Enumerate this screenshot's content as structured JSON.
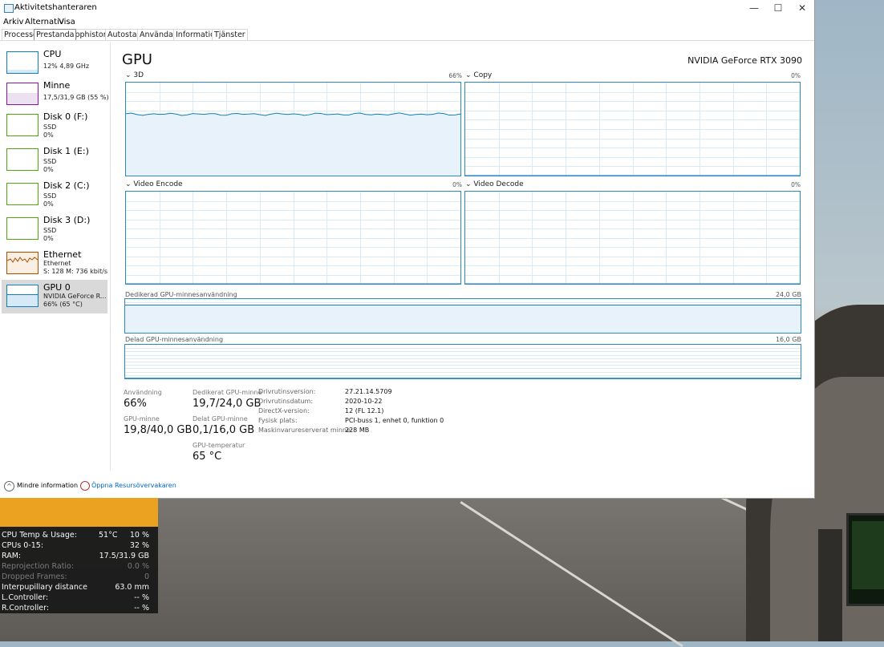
{
  "window": {
    "title": "Aktivitetshanteraren",
    "controls": {
      "minimize": "—",
      "maximize": "☐",
      "close": "✕"
    }
  },
  "menu": [
    "Arkiv",
    "Alternativ",
    "Visa"
  ],
  "tabs": [
    {
      "label": "Processer"
    },
    {
      "label": "Prestanda",
      "active": true
    },
    {
      "label": "Apphistorik"
    },
    {
      "label": "Autostart"
    },
    {
      "label": "Användare"
    },
    {
      "label": "Information"
    },
    {
      "label": "Tjänster"
    }
  ],
  "sidebar": [
    {
      "name": "CPU",
      "line1": "12%  4,89 GHz",
      "line2": "",
      "color": "#117dbb"
    },
    {
      "name": "Minne",
      "line1": "17,5/31,9 GB (55 %)",
      "line2": "",
      "color": "#8b12ae"
    },
    {
      "name": "Disk 0 (F:)",
      "line1": "SSD",
      "line2": "0%",
      "color": "#4da60c"
    },
    {
      "name": "Disk 1 (E:)",
      "line1": "SSD",
      "line2": "0%",
      "color": "#4da60c"
    },
    {
      "name": "Disk 2 (C:)",
      "line1": "SSD",
      "line2": "0%",
      "color": "#4da60c"
    },
    {
      "name": "Disk 3 (D:)",
      "line1": "SSD",
      "line2": "0%",
      "color": "#4da60c"
    },
    {
      "name": "Ethernet",
      "line1": "Ethernet",
      "line2": "S: 128  M: 736 kbit/s",
      "color": "#a74f01"
    },
    {
      "name": "GPU 0",
      "line1": "NVIDIA GeForce R...",
      "line2": "66% (65 °C)",
      "color": "#117dbb",
      "selected": true
    }
  ],
  "main": {
    "title": "GPU",
    "gpu_name": "NVIDIA GeForce RTX 3090",
    "graphs": [
      {
        "label": "3D",
        "percent": "66%",
        "level": 0.66
      },
      {
        "label": "Copy",
        "percent": "0%",
        "level": 0
      },
      {
        "label": "Video Encode",
        "percent": "0%",
        "level": 0
      },
      {
        "label": "Video Decode",
        "percent": "0%",
        "level": 0
      }
    ],
    "dedicated": {
      "label": "Dedikerad GPU-minnesanvändning",
      "max": "24,0 GB",
      "level": 0.82
    },
    "shared": {
      "label": "Delad GPU-minnesanvändning",
      "max": "16,0 GB",
      "level": 0.006
    },
    "stats": {
      "usage_label": "Användning",
      "usage_value": "66%",
      "dedicated_label": "Dedikerat GPU-minne",
      "dedicated_value": "19,7/24,0 GB",
      "gpumem_label": "GPU-minne",
      "gpumem_value": "19,8/40,0 GB",
      "shared_label": "Delat GPU-minne",
      "shared_value": "0,1/16,0 GB",
      "temp_label": "GPU-temperatur",
      "temp_value": "65 °C"
    },
    "info": [
      {
        "k": "Drivrutinsversion:",
        "v": "27.21.14.5709"
      },
      {
        "k": "Drivrutinsdatum:",
        "v": "2020-10-22"
      },
      {
        "k": "DirectX-version:",
        "v": "12 (FL 12.1)"
      },
      {
        "k": "Fysisk plats:",
        "v": "PCI-buss 1, enhet 0, funktion 0"
      },
      {
        "k": "Maskinvarureserverat minne:",
        "v": "228 MB"
      }
    ]
  },
  "footer": {
    "fewer": "Mindre information",
    "resmon": "Öppna Resursövervakaren"
  },
  "overlay": {
    "rows": [
      {
        "a": "CPU Temp & Usage:",
        "b": "51°C",
        "c": "10  %",
        "dim": false
      },
      {
        "a": "CPUs 0-15:",
        "b": "",
        "c": "32  %",
        "dim": false
      },
      {
        "a": "RAM:",
        "b": "",
        "c": "17.5/31.9 GB",
        "dim": false
      },
      {
        "a": "Reprojection Ratio:",
        "b": "",
        "c": "0.0  %",
        "dim": true
      },
      {
        "a": "Dropped Frames:",
        "b": "",
        "c": "0",
        "dim": true
      },
      {
        "a": "Interpupillary distance",
        "b": "",
        "c": "63.0  mm",
        "dim": false
      },
      {
        "a": "L.Controller:",
        "b": "",
        "c": "--  %",
        "dim": false
      },
      {
        "a": "R.Controller:",
        "b": "",
        "c": "--  %",
        "dim": false
      }
    ]
  }
}
